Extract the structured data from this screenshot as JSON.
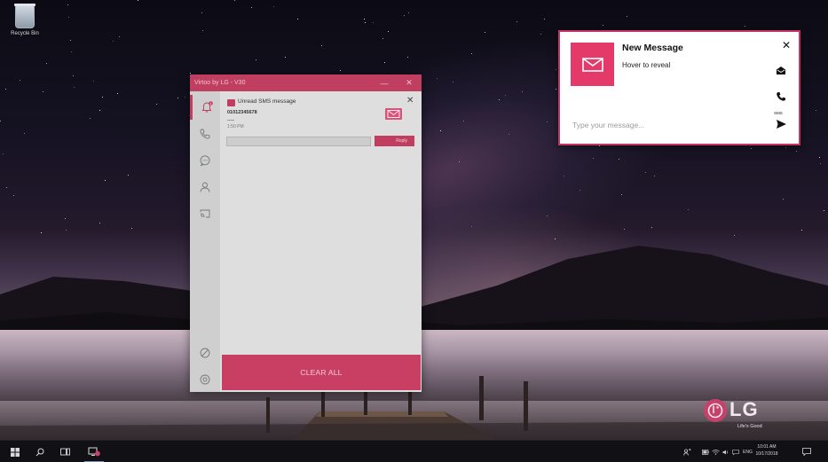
{
  "desktop": {
    "recycle_bin_label": "Recycle Bin"
  },
  "virtoo": {
    "window_title": "Virtoo by LG - V30",
    "minimize_glyph": "—",
    "close_glyph": "✕",
    "sidebar": [
      "notifications",
      "calls",
      "messages",
      "contacts",
      "screen-mirror"
    ],
    "sidebar_bottom": [
      "do-not-disturb",
      "settings"
    ],
    "notifications_badge": "1",
    "notification": {
      "title": "Unread SMS message",
      "sender": "01012345678",
      "time": "1:50 PM",
      "reply_placeholder": "",
      "reply_button": "Reply",
      "close_glyph": "✕"
    },
    "clear_all": "CLEAR ALL",
    "accent_color": "#c03e5f"
  },
  "toast": {
    "title": "New Message",
    "subtitle": "Hover to reveal",
    "close_glyph": "✕",
    "input_placeholder": "Type your message...",
    "sms_label": "SMS",
    "actions": [
      "mark-read-icon",
      "call-icon",
      "send-icon"
    ],
    "accent_color": "#e33a6a"
  },
  "brand": {
    "name": "LG",
    "tagline": "Life's Good"
  },
  "taskbar": {
    "language": "ENG",
    "time": "10:01 AM",
    "date": "10/17/2018"
  }
}
